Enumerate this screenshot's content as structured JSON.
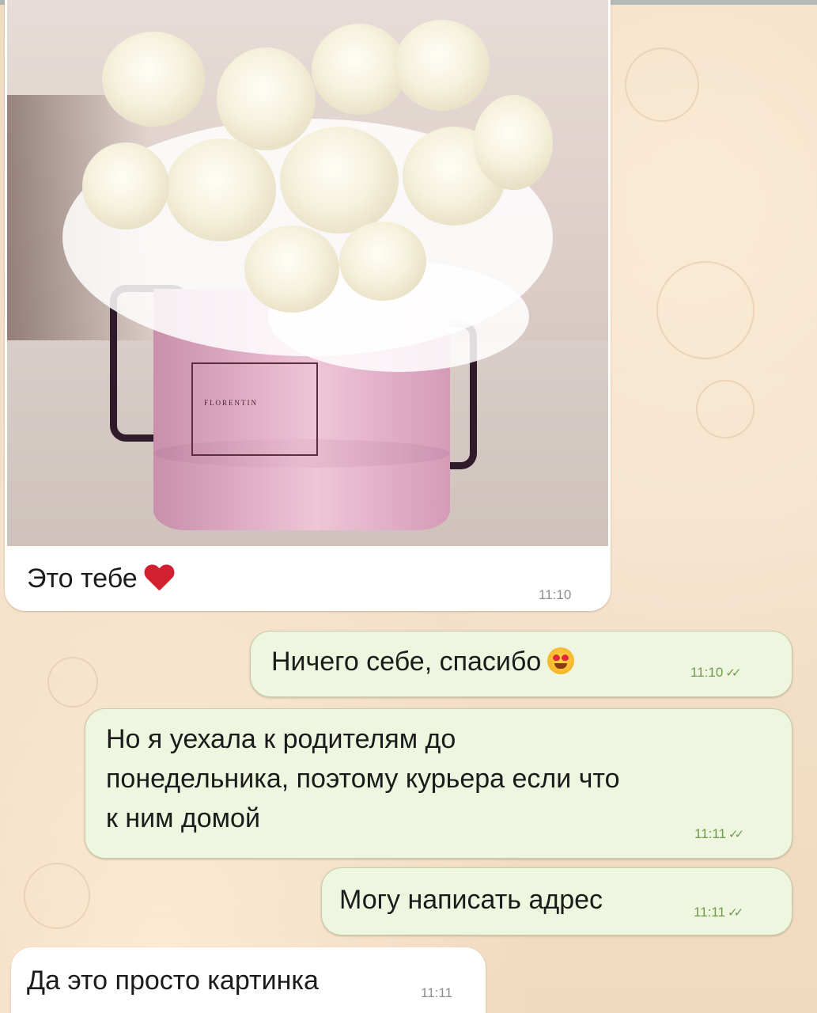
{
  "messages": [
    {
      "id": "m1",
      "direction": "incoming",
      "type": "photo",
      "photo_subject": "white roses in pink hat box",
      "box_brand": "FLORENTIN",
      "caption": "Это тебе",
      "emoji": "red-heart",
      "time": "11:10"
    },
    {
      "id": "m2",
      "direction": "outgoing",
      "text": "Ничего себе, спасибо",
      "emoji": "heart-eyes-face",
      "time": "11:10",
      "status": "read"
    },
    {
      "id": "m3",
      "direction": "outgoing",
      "lines": [
        "Но я уехала к родителям до",
        "понедельника, поэтому курьера если что",
        "к ним домой"
      ],
      "time": "11:11",
      "status": "read"
    },
    {
      "id": "m4",
      "direction": "outgoing",
      "text": "Могу написать адрес",
      "time": "11:11",
      "status": "read"
    },
    {
      "id": "m5",
      "direction": "incoming",
      "text": "Да это просто картинка",
      "time": "11:11"
    }
  ],
  "read_ticks": "✓✓",
  "colors": {
    "incoming": "#ffffff",
    "outgoing": "#eef6df",
    "read_time": "#6f9a4e",
    "heart": "#d3202f"
  }
}
